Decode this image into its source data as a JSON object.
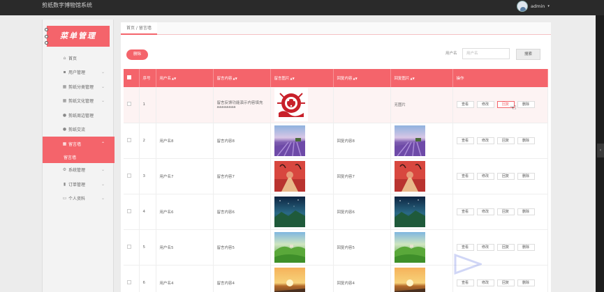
{
  "app": {
    "title": "剪纸数字博物馆系统"
  },
  "user": {
    "name": "admin",
    "caret": "▾"
  },
  "sidebar": {
    "banner": "菜单管理",
    "items": [
      {
        "label": "首页",
        "icon": "home-icon"
      },
      {
        "label": "用户管理",
        "icon": "user-group-icon"
      },
      {
        "label": "剪纸分类管理",
        "icon": "grid-icon"
      },
      {
        "label": "剪纸文化管理",
        "icon": "grid-icon"
      },
      {
        "label": "剪纸周边管理",
        "icon": "user-icon"
      },
      {
        "label": "剪纸交流",
        "icon": "user-icon"
      },
      {
        "label": "留言墙",
        "icon": "grid-icon",
        "active": true
      },
      {
        "label": "留言墙",
        "sub": true
      },
      {
        "label": "系统管理",
        "icon": "gear-icon"
      },
      {
        "label": "订单管理",
        "icon": "bar-chart-icon"
      },
      {
        "label": "个人资料",
        "icon": "id-card-icon"
      }
    ]
  },
  "breadcrumb": "首页 / 留言墙",
  "toolbar": {
    "delete_label": "删除",
    "search_label": "用户名",
    "search_placeholder": "用户名",
    "search_button": "搜索"
  },
  "table": {
    "columns": [
      "序号",
      "用户名",
      "留言内容",
      "留言图片",
      "回复内容",
      "回复图片",
      "操作"
    ],
    "actions": [
      "查看",
      "修改",
      "回复",
      "删除"
    ],
    "rows": [
      {
        "no": "1",
        "user": "",
        "message": "留言反馈功能演示内容填充aaaaaaaa",
        "image": "papercut",
        "reply": "",
        "reply_image": "无图片"
      },
      {
        "no": "2",
        "user": "用户名8",
        "message": "留言内容8",
        "image": "lavender",
        "reply": "回复内容8",
        "reply_image": "lavender"
      },
      {
        "no": "3",
        "user": "用户名7",
        "message": "留言内容7",
        "image": "autumn",
        "reply": "回复内容7",
        "reply_image": "autumn"
      },
      {
        "no": "4",
        "user": "用户名6",
        "message": "留言内容6",
        "image": "night",
        "reply": "回复内容6",
        "reply_image": "night"
      },
      {
        "no": "5",
        "user": "用户名5",
        "message": "留言内容5",
        "image": "hills",
        "reply": "回复内容5",
        "reply_image": "hills"
      },
      {
        "no": "6",
        "user": "用户名4",
        "message": "留言内容4",
        "image": "sunset",
        "reply": "回复内容4",
        "reply_image": "sunset"
      }
    ]
  },
  "colors": {
    "accent": "#f4646b",
    "topbar": "#2a2a2a",
    "sidebar": "#f3f3f3"
  }
}
